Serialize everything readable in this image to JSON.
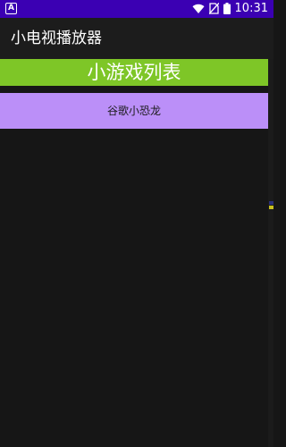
{
  "status_bar": {
    "left_badge": "A",
    "time": "10:31",
    "icons": [
      "wifi-icon",
      "no-sim-icon",
      "battery-icon"
    ],
    "background": "#3b00b3"
  },
  "app_bar": {
    "title": "小电视播放器"
  },
  "header": {
    "title": "小游戏列表",
    "color": "#7ec627"
  },
  "game_list": {
    "items": [
      {
        "label": "谷歌小恐龙",
        "color": "#bb8ff8"
      }
    ]
  }
}
